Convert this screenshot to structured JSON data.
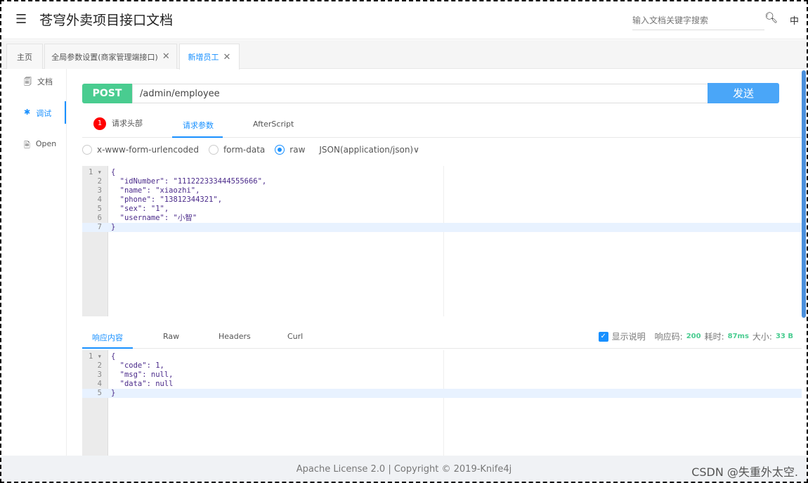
{
  "header": {
    "title": "苍穹外卖项目接口文档",
    "search_placeholder": "输入文档关键字搜索",
    "lang": "中"
  },
  "tabs": [
    {
      "label": "主页"
    },
    {
      "label": "全局参数设置(商家管理端接口)"
    },
    {
      "label": "新增员工"
    }
  ],
  "sidebar": {
    "items": [
      {
        "label": "文档"
      },
      {
        "label": "调试"
      },
      {
        "label": "Open"
      }
    ]
  },
  "request": {
    "method": "POST",
    "url": "/admin/employee",
    "send_label": "发送",
    "subtabs": [
      {
        "label": "请求头部",
        "badge": "1"
      },
      {
        "label": "请求参数"
      },
      {
        "label": "AfterScript"
      }
    ],
    "body_types": [
      "x-www-form-urlencoded",
      "form-data",
      "raw"
    ],
    "selected_body_type": "raw",
    "content_type": "JSON(application/json)∨",
    "lines": [
      "{",
      "  \"idNumber\": \"111222333444555666\",",
      "  \"name\": \"xiaozhi\",",
      "  \"phone\": \"13812344321\",",
      "  \"sex\": \"1\",",
      "  \"username\": \"小智\"",
      "}"
    ]
  },
  "response": {
    "tabs": [
      "响应内容",
      "Raw",
      "Headers",
      "Curl"
    ],
    "show_desc_label": "显示说明",
    "show_desc_checked": true,
    "code_label": "响应码:",
    "code": "200",
    "time_label": "耗时:",
    "time": "87ms",
    "size_label": "大小:",
    "size": "33 B",
    "lines": [
      "{",
      "  \"code\": 1,",
      "  \"msg\": null,",
      "  \"data\": null",
      "}"
    ]
  },
  "footer": {
    "text": "Apache License 2.0 | Copyright © 2019-Knife4j",
    "watermark": "CSDN @失重外太空."
  },
  "colors": {
    "accent": "#1890ff",
    "post": "#49cc90",
    "send": "#4aa6f8"
  }
}
